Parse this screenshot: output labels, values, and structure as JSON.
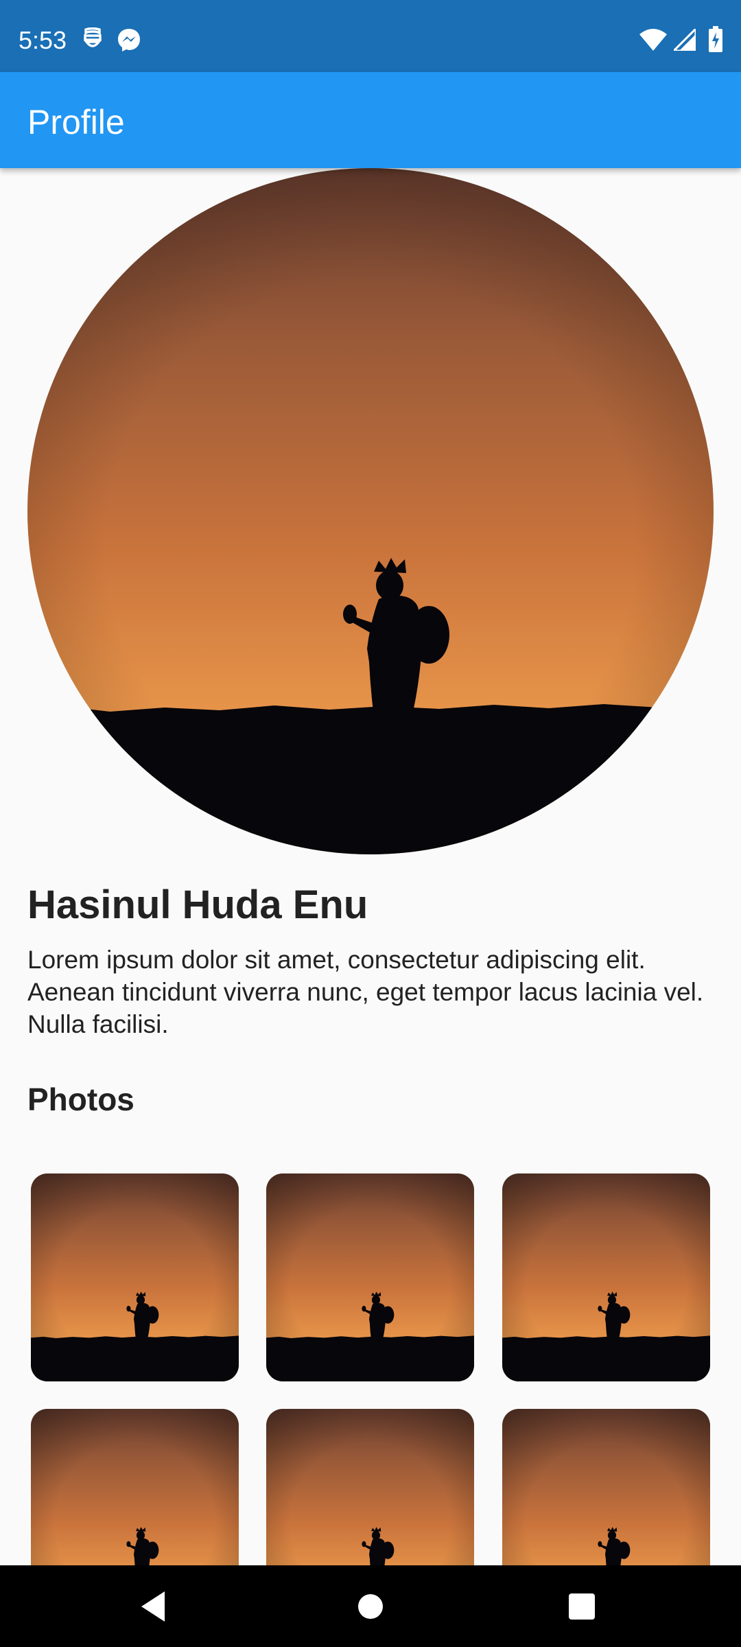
{
  "status_bar": {
    "time": "5:53",
    "icons": [
      "privacy-mask-icon",
      "messenger-icon",
      "wifi-icon",
      "cell-signal-icon",
      "battery-charging-icon"
    ]
  },
  "app_bar": {
    "title": "Profile",
    "color": "#2196f3",
    "status_color": "#1a6fb5"
  },
  "profile": {
    "name": "Hasinul Huda Enu",
    "bio": "Lorem ipsum dolor sit amet, consectetur adipiscing elit. Aenean tincidunt viverra nunc, eget tempor lacus lacinia vel. Nulla facilisi."
  },
  "photos": {
    "heading": "Photos",
    "items": [
      "photo-1",
      "photo-2",
      "photo-3",
      "photo-4",
      "photo-5",
      "photo-6"
    ]
  },
  "nav_bar": {
    "buttons": [
      "back-icon",
      "home-icon",
      "recents-icon"
    ]
  }
}
